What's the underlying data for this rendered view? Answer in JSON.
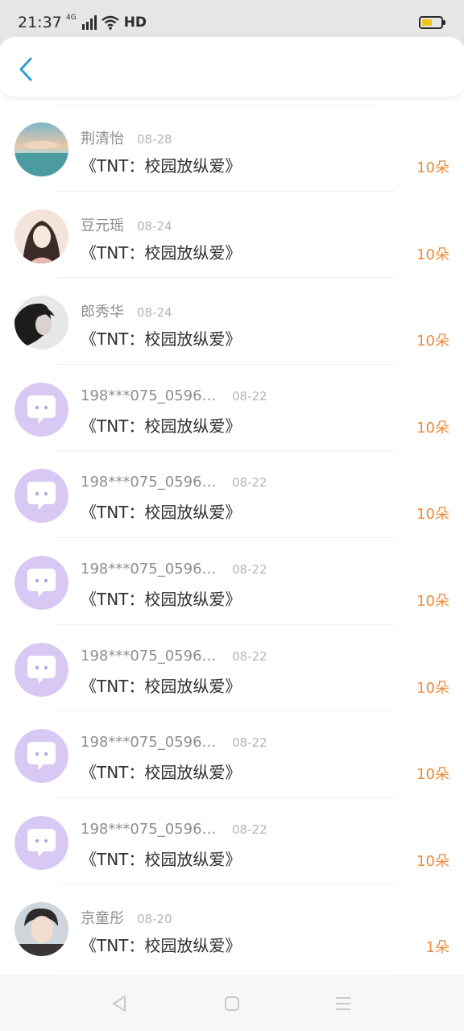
{
  "status_bar": {
    "time": "21:37",
    "network": "4G",
    "connection": "HD",
    "battery_level": 0.55,
    "battery_color": "#f3c31a"
  },
  "header": {
    "back_icon": "chevron-left-icon",
    "accent_color": "#2d9fd8"
  },
  "colors": {
    "amount": "#ea8a3a",
    "default_avatar": "#d8c9f4"
  },
  "items": [
    {
      "name": "荆清怡",
      "date": "08-28",
      "book": "《TNT：校园放纵爱》",
      "amount": "10朵",
      "avatar": "sunset-landscape-avatar"
    },
    {
      "name": "豆元瑶",
      "date": "08-24",
      "book": "《TNT：校园放纵爱》",
      "amount": "10朵",
      "avatar": "illustrated-girl-avatar"
    },
    {
      "name": "郎秀华",
      "date": "08-24",
      "book": "《TNT：校园放纵爱》",
      "amount": "10朵",
      "avatar": "portrait-woman-avatar"
    },
    {
      "name": "198***075_059628...",
      "date": "08-22",
      "book": "《TNT：校园放纵爱》",
      "amount": "10朵",
      "avatar": "default-chat-avatar"
    },
    {
      "name": "198***075_059628...",
      "date": "08-22",
      "book": "《TNT：校园放纵爱》",
      "amount": "10朵",
      "avatar": "default-chat-avatar"
    },
    {
      "name": "198***075_059628...",
      "date": "08-22",
      "book": "《TNT：校园放纵爱》",
      "amount": "10朵",
      "avatar": "default-chat-avatar"
    },
    {
      "name": "198***075_059628...",
      "date": "08-22",
      "book": "《TNT：校园放纵爱》",
      "amount": "10朵",
      "avatar": "default-chat-avatar"
    },
    {
      "name": "198***075_059628...",
      "date": "08-22",
      "book": "《TNT：校园放纵爱》",
      "amount": "10朵",
      "avatar": "default-chat-avatar"
    },
    {
      "name": "198***075_059628...",
      "date": "08-22",
      "book": "《TNT：校园放纵爱》",
      "amount": "10朵",
      "avatar": "default-chat-avatar"
    },
    {
      "name": "京童彤",
      "date": "08-20",
      "book": "《TNT：校园放纵爱》",
      "amount": "1朵",
      "avatar": "portrait-boy-avatar"
    }
  ],
  "nav_bar": {
    "back": "nav-back-icon",
    "home": "nav-home-icon",
    "menu": "nav-menu-icon"
  }
}
